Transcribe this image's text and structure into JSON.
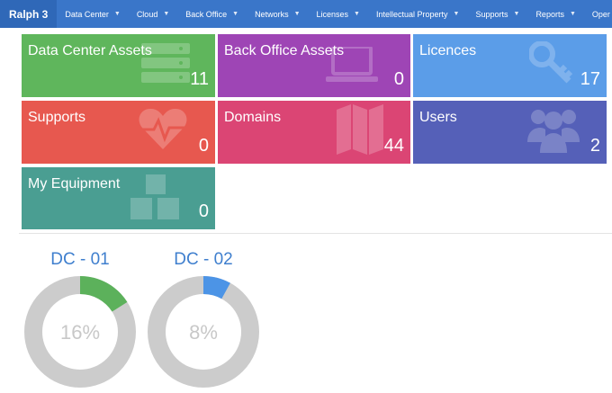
{
  "navbar": {
    "brand": "Ralph 3",
    "items": [
      {
        "label": "Data Center"
      },
      {
        "label": "Cloud"
      },
      {
        "label": "Back Office"
      },
      {
        "label": "Networks"
      },
      {
        "label": "Licenses"
      },
      {
        "label": "Intellectual Property"
      },
      {
        "label": "Supports"
      },
      {
        "label": "Reports"
      },
      {
        "label": "Oper"
      }
    ]
  },
  "tiles": [
    {
      "title": "Data Center Assets",
      "count": "11",
      "color": "#5fb65c",
      "icon": "server-icon"
    },
    {
      "title": "Back Office Assets",
      "count": "0",
      "color": "#9e45b5",
      "icon": "laptop-icon"
    },
    {
      "title": "Licences",
      "count": "17",
      "color": "#5b9de8",
      "icon": "key-icon"
    },
    {
      "title": "Supports",
      "count": "0",
      "color": "#e7584f",
      "icon": "heartbeat-icon"
    },
    {
      "title": "Domains",
      "count": "44",
      "color": "#db4574",
      "icon": "map-icon"
    },
    {
      "title": "Users",
      "count": "2",
      "color": "#5560b8",
      "icon": "users-icon"
    },
    {
      "title": "My Equipment",
      "count": "0",
      "color": "#4a9e92",
      "icon": "cubes-icon"
    }
  ],
  "datacenters": [
    {
      "title": "DC - 01",
      "percent_label": "16%",
      "percent": 16,
      "color": "#5cb15b"
    },
    {
      "title": "DC - 02",
      "percent_label": "8%",
      "percent": 8,
      "color": "#4c94e6"
    }
  ]
}
